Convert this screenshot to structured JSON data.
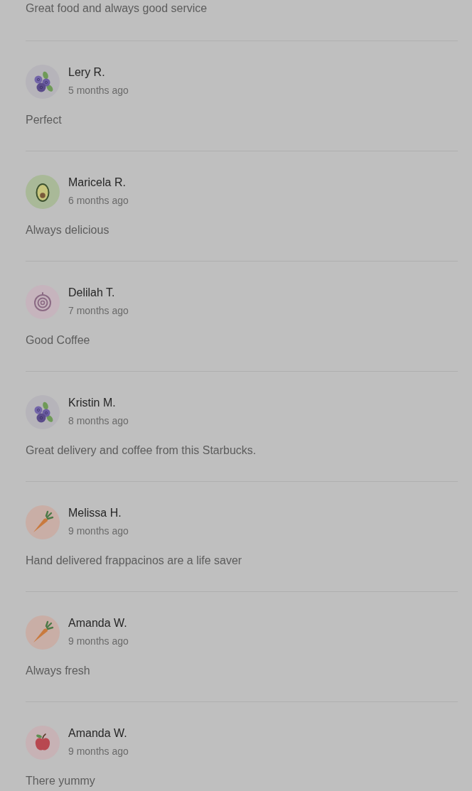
{
  "reviews": [
    {
      "text": "Great food and always good service"
    },
    {
      "name": "Lery R.",
      "time": "5 months ago",
      "kind": "blueberries",
      "text": "Perfect"
    },
    {
      "name": "Maricela R.",
      "time": "6 months ago",
      "kind": "avocado",
      "text": "Always delicious"
    },
    {
      "name": "Delilah T.",
      "time": "7 months ago",
      "kind": "onion",
      "text": "Good Coffee"
    },
    {
      "name": "Kristin M.",
      "time": "8 months ago",
      "kind": "blueberries",
      "text": "Great delivery and coffee from this Starbucks."
    },
    {
      "name": "Melissa H.",
      "time": "9 months ago",
      "kind": "carrot",
      "text": "Hand delivered frappacinos are a life saver"
    },
    {
      "name": "Amanda W.",
      "time": "9 months ago",
      "kind": "carrot",
      "text": "Always fresh"
    },
    {
      "name": "Amanda W.",
      "time": "9 months ago",
      "kind": "apple",
      "text": "There yummy"
    }
  ]
}
